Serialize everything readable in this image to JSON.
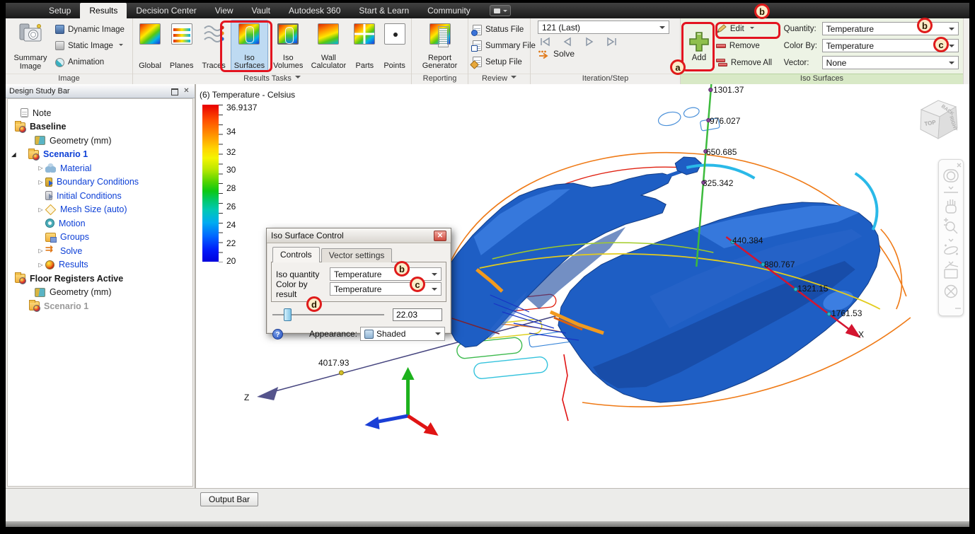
{
  "menubar": {
    "tabs": [
      "Setup",
      "Results",
      "Decision Center",
      "View",
      "Vault",
      "Autodesk 360",
      "Start & Learn",
      "Community"
    ],
    "active_tab": "Results"
  },
  "ribbon": {
    "image": {
      "group_label": "Image",
      "summary_image": "Summary Image",
      "dynamic_image": "Dynamic Image",
      "static_image": "Static Image",
      "animation": "Animation"
    },
    "results_tasks": {
      "group_label": "Results Tasks",
      "global": "Global",
      "planes": "Planes",
      "traces": "Traces",
      "iso_surfaces": "Iso Surfaces",
      "iso_volumes": "Iso Volumes",
      "wall_calculator": "Wall Calculator",
      "parts": "Parts",
      "points": "Points",
      "selected": "Iso Surfaces"
    },
    "reporting": {
      "group_label": "Reporting",
      "report_generator": "Report Generator"
    },
    "review": {
      "group_label": "Review",
      "status_file": "Status File",
      "summary_file": "Summary File",
      "setup_file": "Setup File"
    },
    "iteration": {
      "group_label": "Iteration/Step",
      "value": "121 (Last)",
      "solve": "Solve"
    },
    "iso": {
      "group_label": "Iso Surfaces",
      "add": "Add",
      "edit": "Edit",
      "remove": "Remove",
      "remove_all": "Remove All",
      "quantity_label": "Quantity:",
      "quantity": "Temperature",
      "color_by_label": "Color By:",
      "color_by": "Temperature",
      "vector_label": "Vector:",
      "vector": "None"
    }
  },
  "design_study_bar": {
    "title": "Design Study Bar",
    "tree": {
      "note": "Note",
      "baseline": "Baseline",
      "geometry1": "Geometry (mm)",
      "scenario1": "Scenario 1",
      "material": "Material",
      "boundary": "Boundary Conditions",
      "initial": "Initial Conditions",
      "mesh": "Mesh Size (auto)",
      "motion": "Motion",
      "groups": "Groups",
      "solve": "Solve",
      "results": "Results",
      "floor": "Floor Registers Active",
      "geometry2": "Geometry (mm)",
      "scenario2": "Scenario 1"
    }
  },
  "legend": {
    "title": "(6) Temperature - Celsius",
    "max": "36.9137",
    "ticks": [
      "34",
      "32",
      "30",
      "28",
      "26",
      "24",
      "22",
      "20"
    ]
  },
  "scene": {
    "y_axis_labels": [
      "1301.37",
      "976.027",
      "650.685",
      "325.342"
    ],
    "x_axis_labels": [
      "440.384",
      "880.767",
      "1321.15",
      "1761.53"
    ],
    "x_axis_name": "X",
    "z_axis_label": "4017.93",
    "z_axis_name": "Z"
  },
  "viewcube": {
    "top": "TOP",
    "right": "RIGHT",
    "back": "BACK"
  },
  "dialog": {
    "title": "Iso Surface Control",
    "tab_controls": "Controls",
    "tab_vector": "Vector settings",
    "iso_quantity_label": "Iso quantity",
    "iso_quantity": "Temperature",
    "color_by_label": "Color by result",
    "color_by": "Temperature",
    "slider_value": "22.03",
    "appearance_label": "Appearance:",
    "appearance": "Shaded"
  },
  "annotations": {
    "a": "a",
    "b": "b",
    "c": "c",
    "d": "d"
  },
  "output_bar": {
    "label": "Output Bar"
  },
  "icons": [
    "camera-icon",
    "dynamic-image-icon",
    "static-image-icon",
    "animation-icon",
    "cube-icon",
    "planes-icon",
    "traces-icon",
    "iso-surfaces-icon",
    "iso-volumes-icon",
    "wall-calculator-icon",
    "parts-icon",
    "points-icon",
    "report-generator-icon",
    "status-file-icon",
    "summary-file-icon",
    "setup-file-icon",
    "solve-arrow-icon",
    "add-plus-icon",
    "edit-pencil-icon",
    "remove-icon",
    "remove-all-icon",
    "help-icon",
    "shaded-cube-icon",
    "close-icon",
    "float-panel-icon",
    "steering-wheel-icon",
    "pan-hand-icon",
    "zoom-icon",
    "orbit-icon",
    "look-at-icon",
    "center-icon"
  ],
  "colors": {
    "selection_blue": "#bedaf2",
    "annotation_red": "#e31420",
    "group_highlight_green": "#d8e9c6",
    "legend_top": "#e80000",
    "legend_bottom": "#0000dc"
  }
}
